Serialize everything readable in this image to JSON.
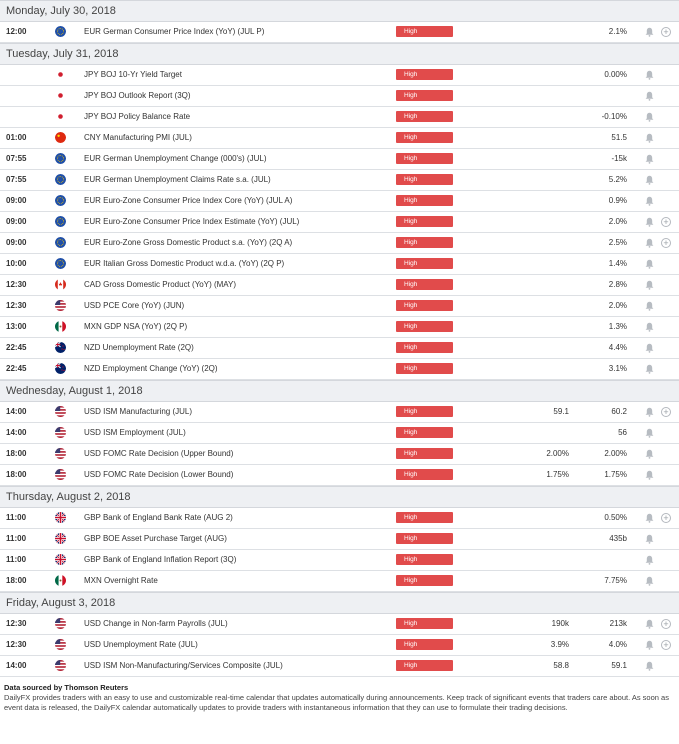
{
  "badge_color": "#e14b4b",
  "days": [
    {
      "title": "Monday, July 30, 2018",
      "events": [
        {
          "time": "12:00",
          "flag": "eu",
          "event": "EUR German Consumer Price Index (YoY) (JUL P)",
          "importance": "High",
          "actual": "",
          "forecast": "2.1%",
          "plus": true
        }
      ]
    },
    {
      "title": "Tuesday, July 31, 2018",
      "events": [
        {
          "time": "",
          "flag": "jp",
          "event": "JPY BOJ 10-Yr Yield Target",
          "importance": "High",
          "actual": "",
          "forecast": "0.00%",
          "plus": false
        },
        {
          "time": "",
          "flag": "jp",
          "event": "JPY BOJ Outlook Report (3Q)",
          "importance": "High",
          "actual": "",
          "forecast": "",
          "plus": false
        },
        {
          "time": "",
          "flag": "jp",
          "event": "JPY BOJ Policy Balance Rate",
          "importance": "High",
          "actual": "",
          "forecast": "-0.10%",
          "plus": false
        },
        {
          "time": "01:00",
          "flag": "cn",
          "event": "CNY Manufacturing PMI (JUL)",
          "importance": "High",
          "actual": "",
          "forecast": "51.5",
          "plus": false
        },
        {
          "time": "07:55",
          "flag": "eu",
          "event": "EUR German Unemployment Change (000's) (JUL)",
          "importance": "High",
          "actual": "",
          "forecast": "-15k",
          "plus": false
        },
        {
          "time": "07:55",
          "flag": "eu",
          "event": "EUR German Unemployment Claims Rate s.a. (JUL)",
          "importance": "High",
          "actual": "",
          "forecast": "5.2%",
          "plus": false
        },
        {
          "time": "09:00",
          "flag": "eu",
          "event": "EUR Euro-Zone Consumer Price Index Core (YoY) (JUL A)",
          "importance": "High",
          "actual": "",
          "forecast": "0.9%",
          "plus": false
        },
        {
          "time": "09:00",
          "flag": "eu",
          "event": "EUR Euro-Zone Consumer Price Index Estimate (YoY) (JUL)",
          "importance": "High",
          "actual": "",
          "forecast": "2.0%",
          "plus": true
        },
        {
          "time": "09:00",
          "flag": "eu",
          "event": "EUR Euro-Zone Gross Domestic Product s.a. (YoY) (2Q A)",
          "importance": "High",
          "actual": "",
          "forecast": "2.5%",
          "plus": true
        },
        {
          "time": "10:00",
          "flag": "eu",
          "event": "EUR Italian Gross Domestic Product w.d.a. (YoY) (2Q P)",
          "importance": "High",
          "actual": "",
          "forecast": "1.4%",
          "plus": false
        },
        {
          "time": "12:30",
          "flag": "ca",
          "event": "CAD Gross Domestic Product (YoY) (MAY)",
          "importance": "High",
          "actual": "",
          "forecast": "2.8%",
          "plus": false
        },
        {
          "time": "12:30",
          "flag": "us",
          "event": "USD PCE Core (YoY) (JUN)",
          "importance": "High",
          "actual": "",
          "forecast": "2.0%",
          "plus": false
        },
        {
          "time": "13:00",
          "flag": "mx",
          "event": "MXN GDP NSA (YoY) (2Q P)",
          "importance": "High",
          "actual": "",
          "forecast": "1.3%",
          "plus": false
        },
        {
          "time": "22:45",
          "flag": "nz",
          "event": "NZD Unemployment Rate (2Q)",
          "importance": "High",
          "actual": "",
          "forecast": "4.4%",
          "plus": false
        },
        {
          "time": "22:45",
          "flag": "nz",
          "event": "NZD Employment Change (YoY) (2Q)",
          "importance": "High",
          "actual": "",
          "forecast": "3.1%",
          "plus": false
        }
      ]
    },
    {
      "title": "Wednesday, August 1, 2018",
      "events": [
        {
          "time": "14:00",
          "flag": "us",
          "event": "USD ISM Manufacturing (JUL)",
          "importance": "High",
          "actual": "59.1",
          "forecast": "60.2",
          "plus": true
        },
        {
          "time": "14:00",
          "flag": "us",
          "event": "USD ISM Employment (JUL)",
          "importance": "High",
          "actual": "",
          "forecast": "56",
          "plus": false
        },
        {
          "time": "18:00",
          "flag": "us",
          "event": "USD FOMC Rate Decision (Upper Bound)",
          "importance": "High",
          "actual": "2.00%",
          "forecast": "2.00%",
          "plus": false
        },
        {
          "time": "18:00",
          "flag": "us",
          "event": "USD FOMC Rate Decision (Lower Bound)",
          "importance": "High",
          "actual": "1.75%",
          "forecast": "1.75%",
          "plus": false
        }
      ]
    },
    {
      "title": "Thursday, August 2, 2018",
      "events": [
        {
          "time": "11:00",
          "flag": "gb",
          "event": "GBP Bank of England Bank Rate (AUG 2)",
          "importance": "High",
          "actual": "",
          "forecast": "0.50%",
          "plus": true
        },
        {
          "time": "11:00",
          "flag": "gb",
          "event": "GBP BOE Asset Purchase Target (AUG)",
          "importance": "High",
          "actual": "",
          "forecast": "435b",
          "plus": false
        },
        {
          "time": "11:00",
          "flag": "gb",
          "event": "GBP Bank of England Inflation Report (3Q)",
          "importance": "High",
          "actual": "",
          "forecast": "",
          "plus": false
        },
        {
          "time": "18:00",
          "flag": "mx",
          "event": "MXN Overnight Rate",
          "importance": "High",
          "actual": "",
          "forecast": "7.75%",
          "plus": false
        }
      ]
    },
    {
      "title": "Friday, August 3, 2018",
      "events": [
        {
          "time": "12:30",
          "flag": "us",
          "event": "USD Change in Non-farm Payrolls (JUL)",
          "importance": "High",
          "actual": "190k",
          "forecast": "213k",
          "plus": true
        },
        {
          "time": "12:30",
          "flag": "us",
          "event": "USD Unemployment Rate (JUL)",
          "importance": "High",
          "actual": "3.9%",
          "forecast": "4.0%",
          "plus": true
        },
        {
          "time": "14:00",
          "flag": "us",
          "event": "USD ISM Non-Manufacturing/Services Composite (JUL)",
          "importance": "High",
          "actual": "58.8",
          "forecast": "59.1",
          "plus": false
        }
      ]
    }
  ],
  "footer": {
    "source": "Data sourced by Thomson Reuters",
    "text": "DailyFX provides traders with an easy to use and customizable real-time calendar that updates automatically during announcements. Keep track of significant events that traders care about. As soon as event data is released, the DailyFX calendar automatically updates to provide traders with instantaneous information that they can use to formulate their trading decisions."
  }
}
